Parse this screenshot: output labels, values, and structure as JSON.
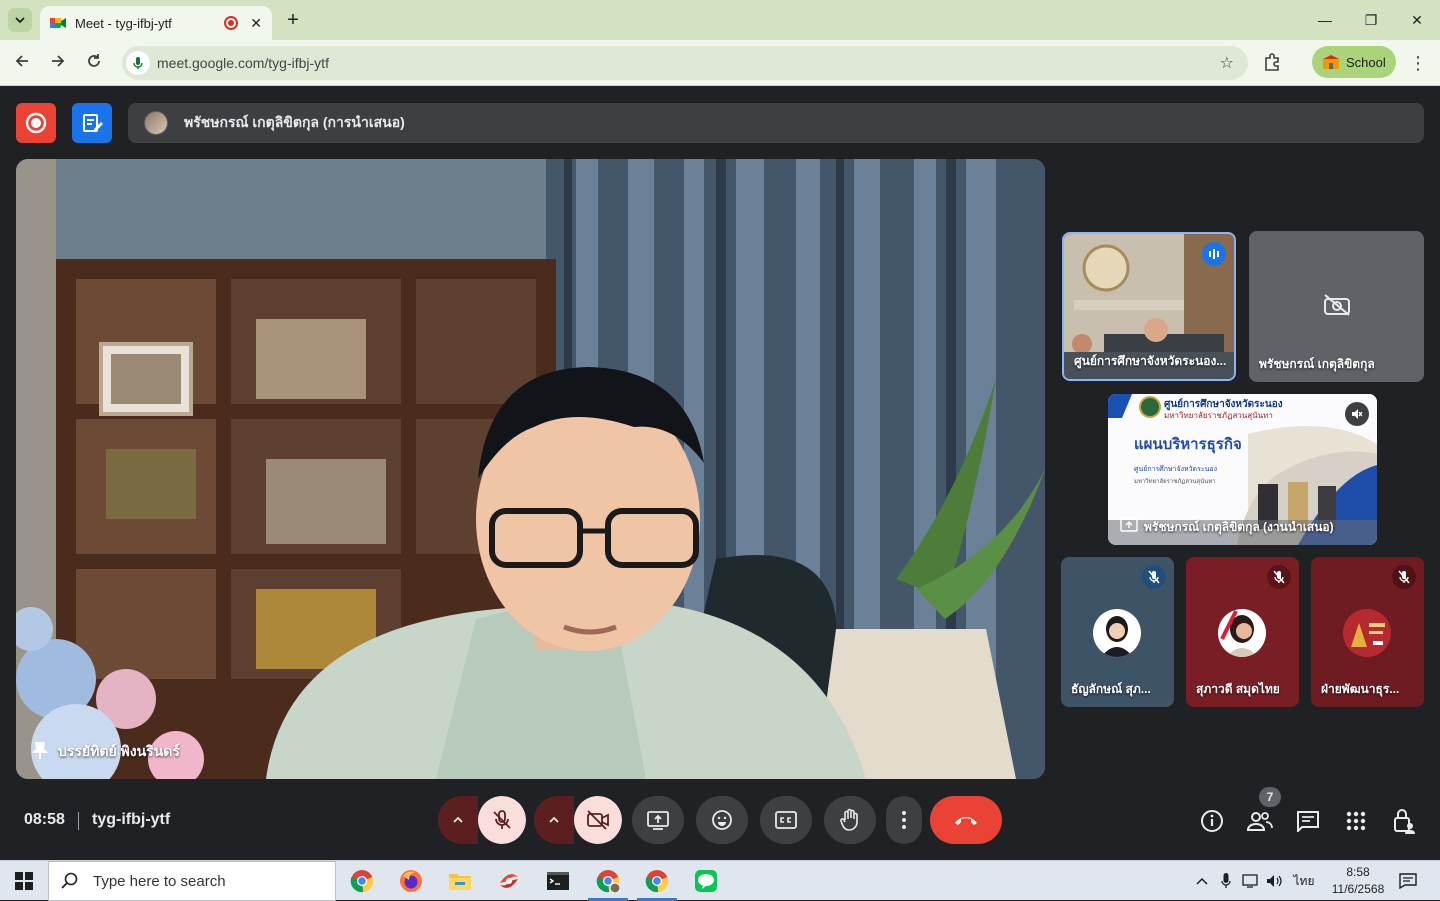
{
  "browser": {
    "tab_title": "Meet - tyg-ifbj-ytf",
    "new_tab_symbol": "+",
    "url": "meet.google.com/tyg-ifbj-ytf",
    "profile_label": "School"
  },
  "meet": {
    "presenting_banner": "พรัชษกรณ์ เกตุลิขิตกุล (การนำเสนอ)",
    "main_speaker_name": "บรรยัทิตย์ พิงนรินดร์",
    "tiles": [
      {
        "name": "ศูนย์การศึกษาจังหวัดระนอง...",
        "status": "speaking"
      },
      {
        "name": "พรัชษกรณ์ เกตุลิขิตกุล",
        "status": "camera-off"
      },
      {
        "name": "พรัชษกรณ์ เกตุลิขิตกุล (งานนำเสนอ)",
        "status": "muted",
        "slide_header": "ศูนย์การศึกษาจังหวัดระนอง",
        "slide_subheader": "มหาวิทยาลัยราชภัฏสวนสุนันทา",
        "slide_title": "แผนบริหารธุรกิจ",
        "slide_line1": "ศูนย์การศึกษาจังหวัดระนอง",
        "slide_line2": "มหาวิทยาลัยราชภัฏสวนสุนันทา"
      },
      {
        "name": "ธัญลักษณ์ สุภ...",
        "status": "muted"
      },
      {
        "name": "สุภาวดี สมุดไทย",
        "status": "muted"
      },
      {
        "name": "ฝ่ายพัฒนาธุร...",
        "status": "muted"
      }
    ],
    "clock": "08:58",
    "meeting_code": "tyg-ifbj-ytf",
    "people_count": "7"
  },
  "taskbar": {
    "search_placeholder": "Type here to search",
    "ime_label": "ไทย",
    "time": "8:58",
    "date": "11/6/2568"
  },
  "colors": {
    "meet_bg": "#202124",
    "leave_red": "#ea4335",
    "accent_blue": "#1a73e8",
    "chrome_green": "#d3e3c1"
  }
}
